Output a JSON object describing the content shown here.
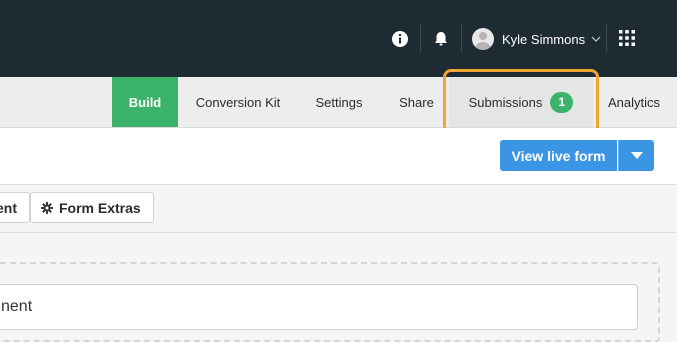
{
  "header": {
    "user_name": "Kyle Simmons"
  },
  "nav": {
    "tabs": [
      {
        "label": "Build"
      },
      {
        "label": "Conversion Kit"
      },
      {
        "label": "Settings"
      },
      {
        "label": "Share"
      },
      {
        "label": "Submissions",
        "badge": "1"
      },
      {
        "label": "Analytics"
      }
    ]
  },
  "actions": {
    "view_live_label": "View live form"
  },
  "subtabs": {
    "left_partial": "ent",
    "extras_label": "Form Extras"
  },
  "canvas": {
    "field_partial": "nent"
  },
  "colors": {
    "topbar": "#1f2b33",
    "build_green": "#3bb36b",
    "primary_blue": "#3a96e4",
    "highlight_orange": "#f2a533"
  }
}
